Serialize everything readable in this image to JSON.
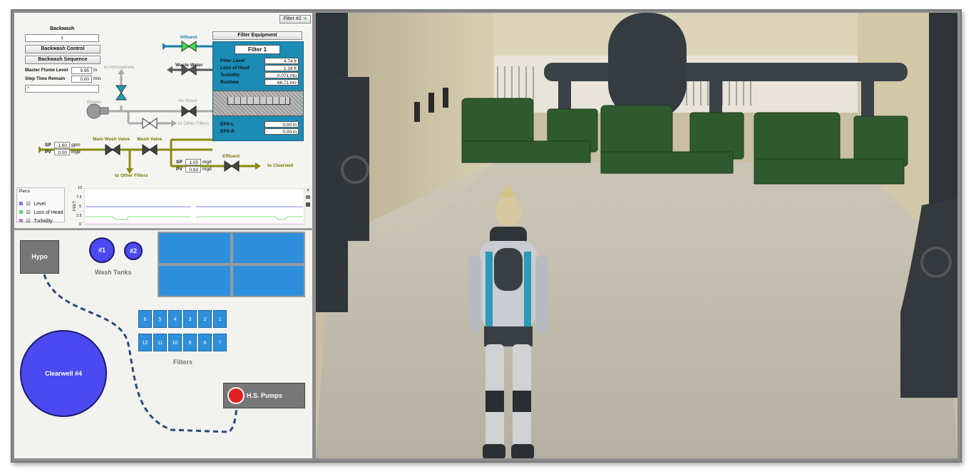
{
  "header": {
    "filter_nav": "Filter #2"
  },
  "backwash": {
    "title": "Backwash",
    "step": "1",
    "control_label": "Backwash Control",
    "sequence_label": "Backwash Sequence",
    "flume_label": "Master Flume Level",
    "flume_value": "9.95",
    "flume_unit": "in",
    "step_time_label": "Step Time Remain",
    "step_time_value": "0.00",
    "step_time_unit": "min",
    "message": "*"
  },
  "process": {
    "to_atmosphere": "to Atmosphere",
    "blower": "Blower",
    "air_scour": "Air Scour",
    "to_other_filters_1": "to Other Filters",
    "main_wash_valve": "Main Wash Valve",
    "wash_valve": "Wash Valve",
    "to_other_filters_2": "to Other Filters",
    "influent": "Influent",
    "waste_water": "Waste Water",
    "effluent": "Effluent",
    "to_clearwell": "to Clearwell",
    "sp1_label": "SP",
    "sp1_value": "-1.60",
    "sp1_unit": "gpm",
    "pv1_label": "PV",
    "pv1_value": "0.00",
    "pv1_unit": "mgd",
    "sp2_label": "SP",
    "sp2_value": "1.05",
    "sp2_unit": "mgd",
    "pv2_label": "PV",
    "pv2_value": "0.93",
    "pv2_unit": "mgd"
  },
  "filter_panel": {
    "equipment_button": "Filter Equipment",
    "title": "Filter 1",
    "rows": [
      {
        "label": "Filter Level",
        "value": "4.74 ft"
      },
      {
        "label": "Loss of Head",
        "value": "1.18 ft"
      },
      {
        "label": "Turbidity",
        "value": "0.071 ntu"
      },
      {
        "label": "Runtime",
        "value": "66.71 hrs"
      }
    ],
    "eps": [
      {
        "label": "EPS-L",
        "value": "0.00 in"
      },
      {
        "label": "EPS-R",
        "value": "0.00 in"
      }
    ]
  },
  "pens": {
    "title": "Pens",
    "items": [
      {
        "label": "Level",
        "color": "#7a7aff"
      },
      {
        "label": "Loss of Head",
        "color": "#66cc66"
      },
      {
        "label": "Turbidity",
        "color": "#d070d0"
      }
    ],
    "y_axis_label": "FEET",
    "ticks": [
      "10",
      "7.5",
      "5",
      "2.5",
      "0"
    ]
  },
  "plant": {
    "hypo": "Hypo",
    "tank1": "#1",
    "tank2": "#2",
    "wash_tanks": "Wash Tanks",
    "clearwell": "Clearwell #4",
    "filters_label": "Filters",
    "filters_row1": [
      "6",
      "5",
      "4",
      "3",
      "2",
      "1"
    ],
    "filters_row2": [
      "12",
      "11",
      "10",
      "9",
      "8",
      "7"
    ],
    "hs_pumps": "H.S. Pumps"
  },
  "colors": {
    "filter_blue": "#1b8cb5",
    "tank_blue": "#4a4af0",
    "tile_blue": "#2e8fdc",
    "olive_pipe": "#8a8a10",
    "pump_green": "#2f5a2f",
    "pipe_dash": "#2a4a7a",
    "alarm_red": "#e02020"
  }
}
